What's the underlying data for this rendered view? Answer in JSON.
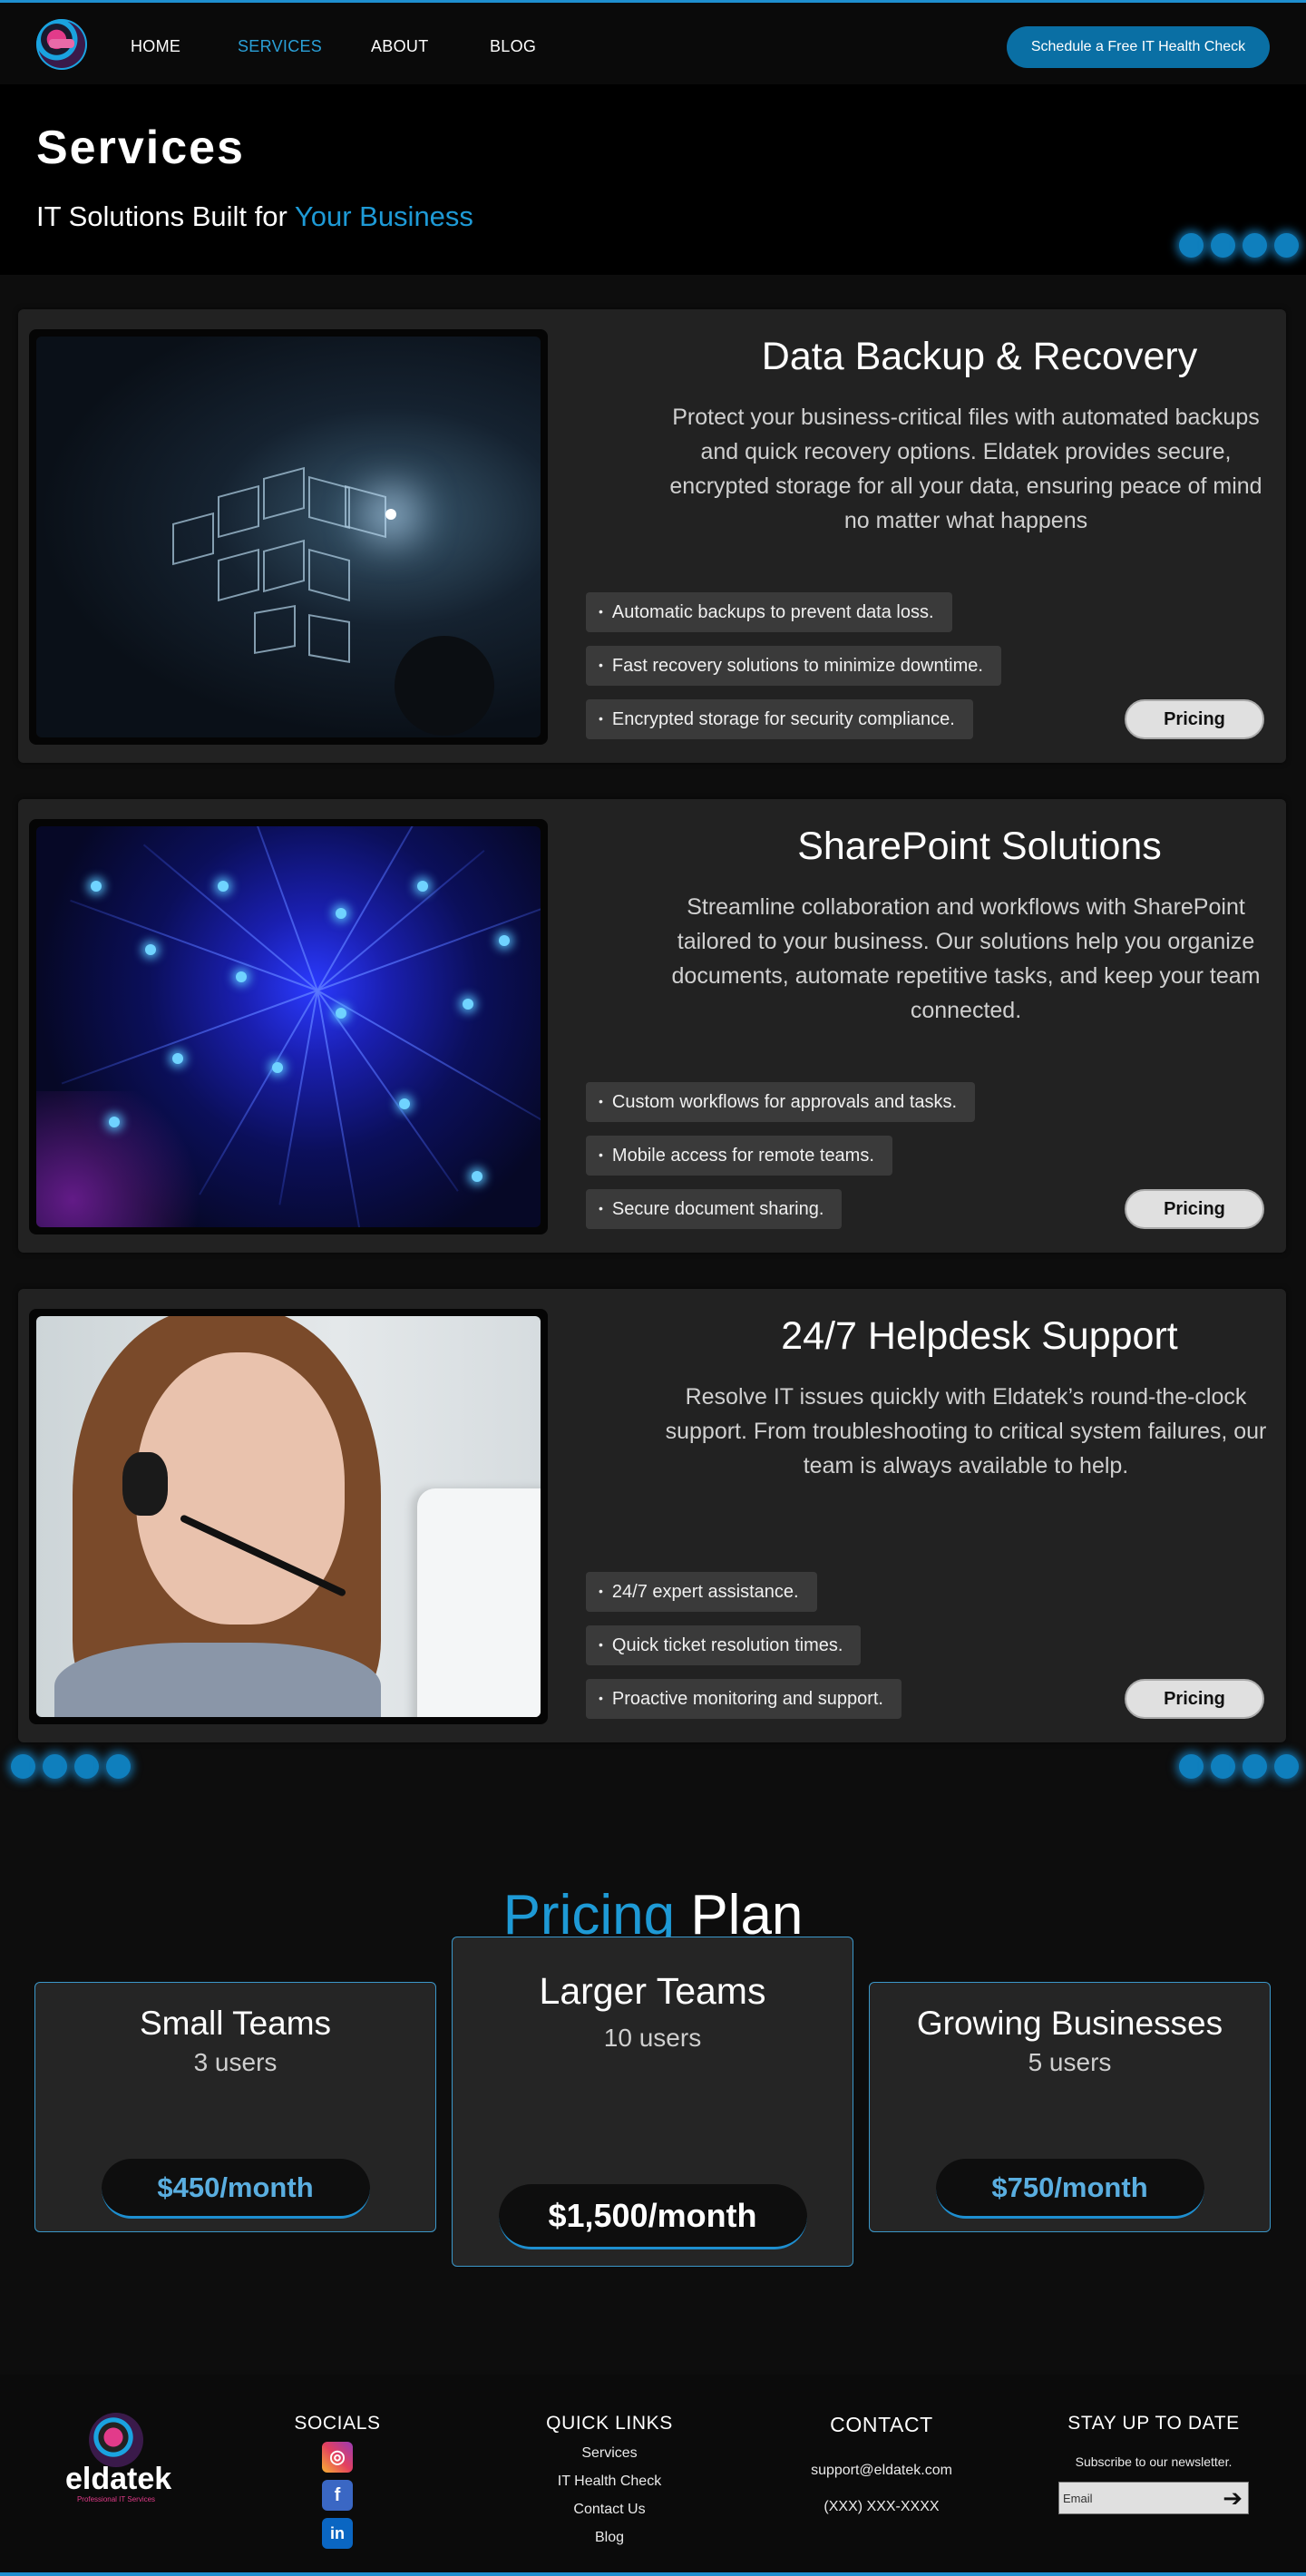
{
  "nav": {
    "links": [
      {
        "label": "HOME",
        "active": false
      },
      {
        "label": "SERVICES",
        "active": true
      },
      {
        "label": "ABOUT",
        "active": false
      },
      {
        "label": "BLOG",
        "active": false
      }
    ],
    "cta": "Schedule a Free IT Health Check"
  },
  "hero": {
    "title": "Services",
    "subtitle_prefix": "IT Solutions Built for ",
    "subtitle_accent": "Your Business"
  },
  "services": [
    {
      "title": "Data Backup & Recovery",
      "description": "Protect your business-critical files with automated backups and quick recovery options. Eldatek provides secure, encrypted storage for all your data, ensuring peace of mind no matter what happens",
      "features": [
        "Automatic backups to prevent data loss.",
        "Fast recovery solutions to minimize downtime.",
        "Encrypted storage for security compliance."
      ],
      "button": "Pricing"
    },
    {
      "title": "SharePoint Solutions",
      "description": "Streamline collaboration and workflows with SharePoint tailored to your business. Our solutions help you organize documents, automate repetitive tasks, and keep your team connected.",
      "features": [
        "Custom workflows for approvals and tasks.",
        "Mobile access for remote teams.",
        "Secure document sharing."
      ],
      "button": "Pricing"
    },
    {
      "title": "24/7 Helpdesk Support",
      "description": "Resolve IT issues quickly with Eldatek’s round-the-clock support. From troubleshooting to critical system failures, our team is always available to help.",
      "features": [
        "24/7 expert assistance.",
        "Quick ticket resolution times.",
        "Proactive monitoring and support."
      ],
      "button": "Pricing"
    }
  ],
  "pricing": {
    "title_accent": "Pricing",
    "title_rest": " Plan",
    "plans": [
      {
        "name": "Small Teams",
        "users": "3 users",
        "price": "$450/month"
      },
      {
        "name": "Larger Teams",
        "users": "10 users",
        "price": "$1,500/month"
      },
      {
        "name": "Growing Businesses",
        "users": "5 users",
        "price": "$750/month"
      }
    ]
  },
  "footer": {
    "logo_word": "eldatek",
    "logo_tag": "Professional IT Services",
    "socials": {
      "title": "SOCIALS",
      "icons": [
        "instagram-icon",
        "facebook-icon",
        "linkedin-icon"
      ]
    },
    "quick_links": {
      "title": "QUICK LINKS",
      "items": [
        "Services",
        "IT Health Check",
        "Contact Us",
        "Blog"
      ]
    },
    "contact": {
      "title": "CONTACT",
      "email": "support@eldatek.com",
      "phone": "(XXX) XXX-XXXX"
    },
    "newsletter": {
      "title": "STAY UP TO DATE",
      "subtitle": "Subscribe to our newsletter.",
      "placeholder": "Email"
    }
  },
  "colors": {
    "accent": "#1e9ad6",
    "cta": "#0a6fa4",
    "card": "#222222",
    "page": "#0b0b0b"
  }
}
